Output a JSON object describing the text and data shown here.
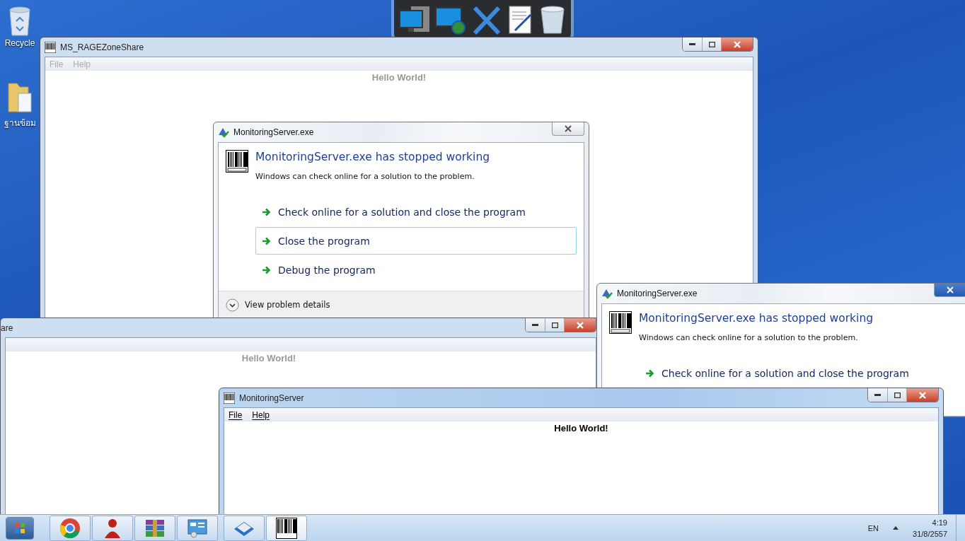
{
  "desktop_icons": [
    {
      "kind": "recycle",
      "label": "Recycle"
    },
    {
      "kind": "folder",
      "label": "ฐานข้อม"
    }
  ],
  "windows": [
    {
      "title": "MS_RAGEZoneShare",
      "menu": [
        "File",
        "Help"
      ],
      "body_text": "Hello World!",
      "active": false
    },
    {
      "title": "are",
      "body_text": "Hello World!",
      "active": false
    },
    {
      "title": "MonitoringServer",
      "menu": [
        "File",
        "Help"
      ],
      "body_text": "Hello World!",
      "active": true
    }
  ],
  "dialogs": [
    {
      "title": "MonitoringServer.exe",
      "heading": "MonitoringServer.exe has stopped working",
      "message": "Windows can check online for a solution to the problem.",
      "options": [
        {
          "label": "Check online for a solution and close the program",
          "selected": false
        },
        {
          "label": "Close the program",
          "selected": true
        },
        {
          "label": "Debug the program",
          "selected": false
        }
      ],
      "details_label": "View problem details"
    },
    {
      "title": "MonitoringServer.exe",
      "heading": "MonitoringServer.exe has stopped working",
      "message": "Windows can check online for a solution to the problem.",
      "options": [
        {
          "label": "Check online for a solution and close the program",
          "selected": false
        }
      ]
    }
  ],
  "tray": {
    "language": "EN",
    "time": "4:19",
    "date": "31/8/2557"
  }
}
